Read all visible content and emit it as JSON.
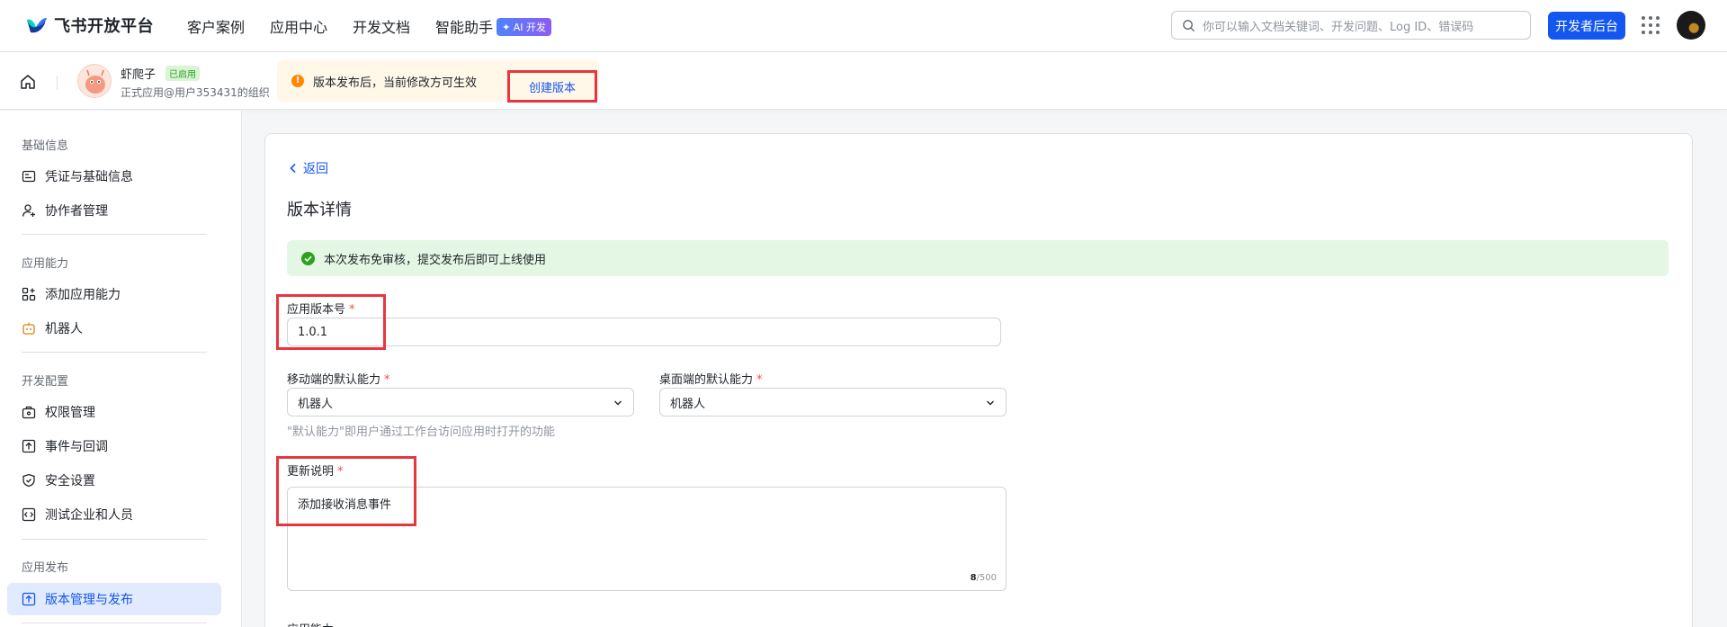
{
  "topnav": {
    "brand": "飞书开放平台",
    "links": [
      "客户案例",
      "应用中心",
      "开发文档",
      "智能助手"
    ],
    "ai_badge": "✦ AI 开发",
    "search_placeholder": "你可以输入文档关键词、开发问题、Log ID、错误码",
    "dev_console": "开发者后台"
  },
  "appbar": {
    "app_name": "虾爬子",
    "app_status": "已启用",
    "app_org": "正式应用@用户353431的组织",
    "notice": "版本发布后，当前修改方可生效",
    "notice_icon": "!",
    "create_version": "创建版本"
  },
  "sidebar": {
    "sections": [
      {
        "title": "基础信息",
        "items": [
          "凭证与基础信息",
          "协作者管理"
        ]
      },
      {
        "title": "应用能力",
        "items": [
          "添加应用能力",
          "机器人"
        ]
      },
      {
        "title": "开发配置",
        "items": [
          "权限管理",
          "事件与回调",
          "安全设置",
          "测试企业和人员"
        ]
      },
      {
        "title": "应用发布",
        "items": [
          "版本管理与发布"
        ]
      }
    ],
    "active": "版本管理与发布"
  },
  "main": {
    "back": "返回",
    "title": "版本详情",
    "success": "本次发布免审核，提交发布后即可上线使用",
    "version_label": "应用版本号",
    "version_value": "1.0.1",
    "mobile_label": "移动端的默认能力",
    "mobile_value": "机器人",
    "desktop_label": "桌面端的默认能力",
    "desktop_value": "机器人",
    "default_hint": "\"默认能力\"即用户通过工作台访问应用时打开的功能",
    "notes_label": "更新说明",
    "notes_value": "添加接收消息事件",
    "notes_count": "8",
    "notes_max": "/500",
    "required_mark": "*",
    "next_label": "应用能力"
  },
  "colors": {
    "primary": "#1456f0",
    "highlight": "#e8363f",
    "success_bg": "#e4f6e4",
    "notice_bg": "#fff7e8"
  }
}
